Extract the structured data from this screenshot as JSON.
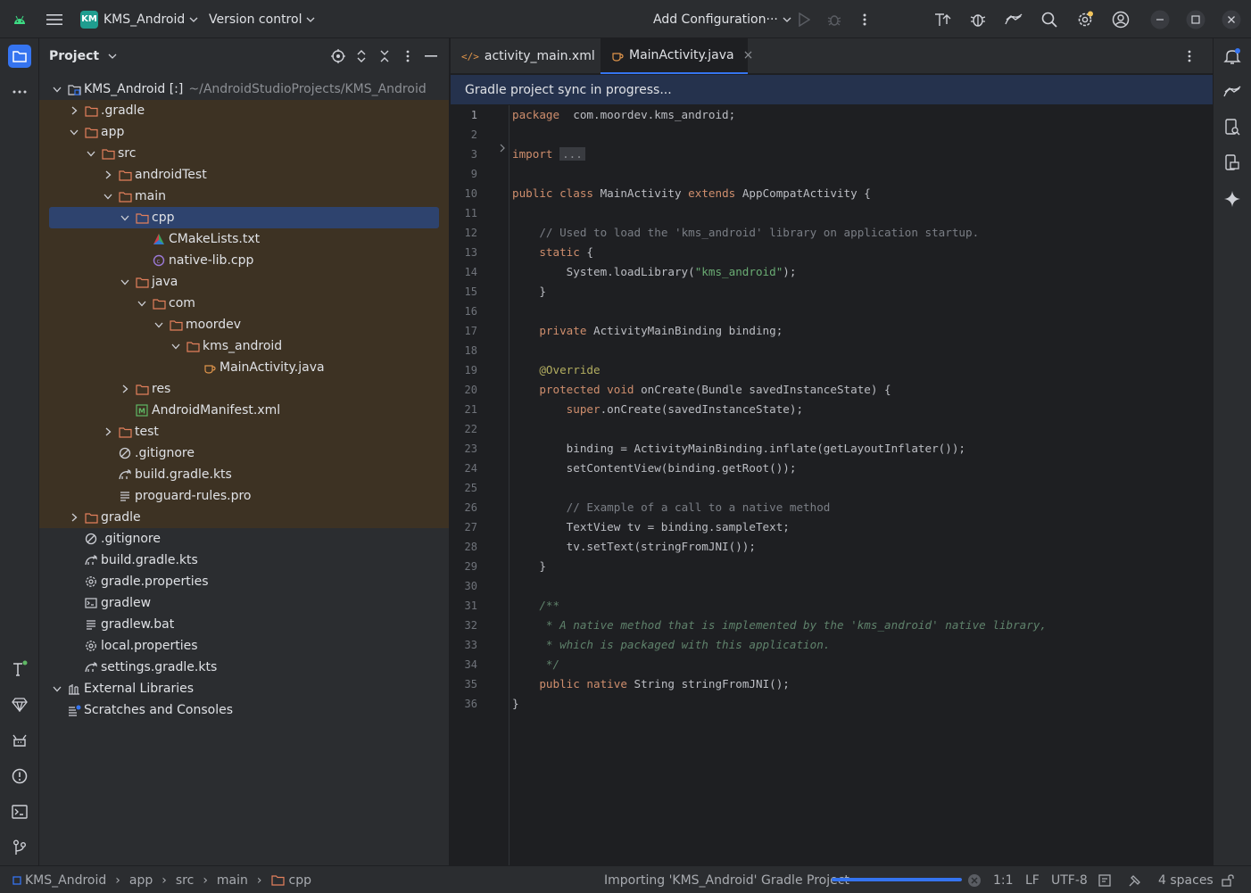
{
  "titlebar": {
    "project_badge": "KM",
    "project_name": "KMS_Android",
    "vcs": "Version control",
    "run_config": "Add Configuration···",
    "icons": [
      "android-icon",
      "hamburger-menu-icon",
      "run-icon",
      "debug-icon",
      "more-vert-icon",
      "sync-gradle-icon",
      "app-inspection-icon",
      "device-manager-icon",
      "search-icon",
      "settings-icon",
      "account-icon",
      "minimize-icon",
      "maximize-icon",
      "close-icon"
    ]
  },
  "project_panel": {
    "title": "Project",
    "tree": [
      {
        "depth": 0,
        "chevron": "down",
        "icon": "module",
        "label": "KMS_Android [:]",
        "dim": "~/AndroidStudioProjects/KMS_Android",
        "state": "normal"
      },
      {
        "depth": 1,
        "chevron": "right",
        "icon": "folder",
        "label": ".gradle",
        "state": "mod"
      },
      {
        "depth": 1,
        "chevron": "down",
        "icon": "folder",
        "label": "app",
        "state": "mod"
      },
      {
        "depth": 2,
        "chevron": "down",
        "icon": "folder",
        "label": "src",
        "state": "mod"
      },
      {
        "depth": 3,
        "chevron": "right",
        "icon": "folder",
        "label": "androidTest",
        "state": "mod"
      },
      {
        "depth": 3,
        "chevron": "down",
        "icon": "folder",
        "label": "main",
        "state": "mod"
      },
      {
        "depth": 4,
        "chevron": "down",
        "icon": "folder",
        "label": "cpp",
        "state": "sel"
      },
      {
        "depth": 5,
        "chevron": "none",
        "icon": "cmake",
        "label": "CMakeLists.txt",
        "state": "mod"
      },
      {
        "depth": 5,
        "chevron": "none",
        "icon": "cpp",
        "label": "native-lib.cpp",
        "state": "mod"
      },
      {
        "depth": 4,
        "chevron": "down",
        "icon": "folder",
        "label": "java",
        "state": "mod"
      },
      {
        "depth": 5,
        "chevron": "down",
        "icon": "folder",
        "label": "com",
        "state": "mod"
      },
      {
        "depth": 6,
        "chevron": "down",
        "icon": "folder",
        "label": "moordev",
        "state": "mod"
      },
      {
        "depth": 7,
        "chevron": "down",
        "icon": "folder",
        "label": "kms_android",
        "state": "mod"
      },
      {
        "depth": 8,
        "chevron": "none",
        "icon": "java",
        "label": "MainActivity.java",
        "state": "mod"
      },
      {
        "depth": 4,
        "chevron": "right",
        "icon": "folder",
        "label": "res",
        "state": "mod"
      },
      {
        "depth": 4,
        "chevron": "none",
        "icon": "manifest",
        "label": "AndroidManifest.xml",
        "state": "mod"
      },
      {
        "depth": 3,
        "chevron": "right",
        "icon": "folder",
        "label": "test",
        "state": "mod"
      },
      {
        "depth": 3,
        "chevron": "none",
        "icon": "ignore",
        "label": ".gitignore",
        "state": "mod"
      },
      {
        "depth": 3,
        "chevron": "none",
        "icon": "gradle",
        "label": "build.gradle.kts",
        "state": "mod"
      },
      {
        "depth": 3,
        "chevron": "none",
        "icon": "text",
        "label": "proguard-rules.pro",
        "state": "mod"
      },
      {
        "depth": 1,
        "chevron": "right",
        "icon": "folder",
        "label": "gradle",
        "state": "mod"
      },
      {
        "depth": 1,
        "chevron": "none",
        "icon": "ignore",
        "label": ".gitignore",
        "state": "normal"
      },
      {
        "depth": 1,
        "chevron": "none",
        "icon": "gradle",
        "label": "build.gradle.kts",
        "state": "normal"
      },
      {
        "depth": 1,
        "chevron": "none",
        "icon": "gear",
        "label": "gradle.properties",
        "state": "normal"
      },
      {
        "depth": 1,
        "chevron": "none",
        "icon": "terminal",
        "label": "gradlew",
        "state": "normal"
      },
      {
        "depth": 1,
        "chevron": "none",
        "icon": "text",
        "label": "gradlew.bat",
        "state": "normal"
      },
      {
        "depth": 1,
        "chevron": "none",
        "icon": "gear",
        "label": "local.properties",
        "state": "normal"
      },
      {
        "depth": 1,
        "chevron": "none",
        "icon": "gradle",
        "label": "settings.gradle.kts",
        "state": "normal"
      },
      {
        "depth": 0,
        "chevron": "down",
        "icon": "library",
        "label": "External Libraries",
        "state": "normal"
      },
      {
        "depth": 0,
        "chevron": "none",
        "icon": "scratch",
        "label": "Scratches and Consoles",
        "state": "normal"
      }
    ]
  },
  "editor": {
    "tabs": [
      {
        "label": "activity_main.xml",
        "icon": "xml-icon",
        "active": false
      },
      {
        "label": "MainActivity.java",
        "icon": "java-icon",
        "active": true
      }
    ],
    "tab_close": "×",
    "sync_message": "Gradle project sync in progress...",
    "current_line": "1",
    "lines": [
      {
        "n": "1",
        "seg": [
          [
            "kw",
            "package"
          ],
          [
            "",
            "  com.moordev.kms_android;"
          ]
        ]
      },
      {
        "n": "2",
        "seg": []
      },
      {
        "n": "3",
        "seg": [
          [
            "kw",
            "import"
          ],
          [
            "",
            " "
          ],
          [
            "fold",
            "..."
          ]
        ]
      },
      {
        "n": "9",
        "seg": []
      },
      {
        "n": "10",
        "seg": [
          [
            "kw",
            "public class"
          ],
          [
            "",
            " MainActivity "
          ],
          [
            "kw",
            "extends"
          ],
          [
            "",
            " AppCompatActivity {"
          ]
        ]
      },
      {
        "n": "11",
        "seg": []
      },
      {
        "n": "12",
        "seg": [
          [
            "",
            "    "
          ],
          [
            "cm",
            "// Used to load the 'kms_android' library on application startup."
          ]
        ]
      },
      {
        "n": "13",
        "seg": [
          [
            "",
            "    "
          ],
          [
            "kw",
            "static"
          ],
          [
            "",
            " {"
          ]
        ]
      },
      {
        "n": "14",
        "seg": [
          [
            "",
            "        System.loadLibrary("
          ],
          [
            "st",
            "\"kms_android\""
          ],
          [
            "",
            ");"
          ]
        ]
      },
      {
        "n": "15",
        "seg": [
          [
            "",
            "    }"
          ]
        ]
      },
      {
        "n": "16",
        "seg": []
      },
      {
        "n": "17",
        "seg": [
          [
            "",
            "    "
          ],
          [
            "kw",
            "private"
          ],
          [
            "",
            " ActivityMainBinding binding;"
          ]
        ]
      },
      {
        "n": "18",
        "seg": []
      },
      {
        "n": "19",
        "seg": [
          [
            "",
            "    "
          ],
          [
            "an",
            "@Override"
          ]
        ]
      },
      {
        "n": "20",
        "seg": [
          [
            "",
            "    "
          ],
          [
            "kw",
            "protected void"
          ],
          [
            "",
            " onCreate(Bundle savedInstanceState) {"
          ]
        ]
      },
      {
        "n": "21",
        "seg": [
          [
            "",
            "        "
          ],
          [
            "kw",
            "super"
          ],
          [
            "",
            ".onCreate(savedInstanceState);"
          ]
        ]
      },
      {
        "n": "22",
        "seg": []
      },
      {
        "n": "23",
        "seg": [
          [
            "",
            "        binding = ActivityMainBinding.inflate(getLayoutInflater());"
          ]
        ]
      },
      {
        "n": "24",
        "seg": [
          [
            "",
            "        setContentView(binding.getRoot());"
          ]
        ]
      },
      {
        "n": "25",
        "seg": []
      },
      {
        "n": "26",
        "seg": [
          [
            "",
            "        "
          ],
          [
            "cm",
            "// Example of a call to a native method"
          ]
        ]
      },
      {
        "n": "27",
        "seg": [
          [
            "",
            "        TextView tv = binding.sampleText;"
          ]
        ]
      },
      {
        "n": "28",
        "seg": [
          [
            "",
            "        tv.setText(stringFromJNI());"
          ]
        ]
      },
      {
        "n": "29",
        "seg": [
          [
            "",
            "    }"
          ]
        ]
      },
      {
        "n": "30",
        "seg": []
      },
      {
        "n": "31",
        "seg": [
          [
            "",
            "    "
          ],
          [
            "dc",
            "/**"
          ]
        ]
      },
      {
        "n": "32",
        "seg": [
          [
            "",
            "     "
          ],
          [
            "dc",
            "* A native method that is implemented by the 'kms_android' native library,"
          ]
        ]
      },
      {
        "n": "33",
        "seg": [
          [
            "",
            "     "
          ],
          [
            "dc",
            "* which is packaged with this application."
          ]
        ]
      },
      {
        "n": "34",
        "seg": [
          [
            "",
            "     "
          ],
          [
            "dc",
            "*/"
          ]
        ]
      },
      {
        "n": "35",
        "seg": [
          [
            "",
            "    "
          ],
          [
            "kw",
            "public native"
          ],
          [
            "",
            " String stringFromJNI();"
          ]
        ]
      },
      {
        "n": "36",
        "seg": [
          [
            "",
            "}"
          ]
        ]
      }
    ]
  },
  "statusbar": {
    "breadcrumb": [
      "KMS_Android",
      "app",
      "src",
      "main",
      "cpp"
    ],
    "separator": "›",
    "task": "Importing 'KMS_Android' Gradle Project",
    "progress": 1.0,
    "position": "1:1",
    "line_sep": "LF",
    "encoding": "UTF-8",
    "indent": "4 spaces"
  },
  "colors": {
    "accent": "#3574f0",
    "modified_bg": "#3d3223",
    "selection_bg": "#2e436e",
    "keyword": "#cf8e6d",
    "string": "#6aab73",
    "comment": "#7a7e85",
    "doc_comment": "#5f826b"
  }
}
